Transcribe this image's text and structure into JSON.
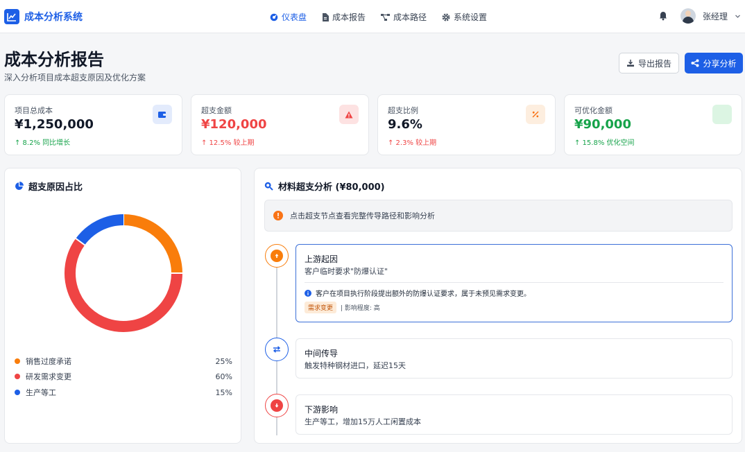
{
  "app": {
    "title": "成本分析系统"
  },
  "nav": [
    {
      "label": "仪表盘",
      "icon": "dashboard-icon",
      "active": true
    },
    {
      "label": "成本报告",
      "icon": "document-icon",
      "active": false
    },
    {
      "label": "成本路径",
      "icon": "network-icon",
      "active": false
    },
    {
      "label": "系统设置",
      "icon": "gear-icon",
      "active": false
    }
  ],
  "user": {
    "name": "张经理"
  },
  "page": {
    "title": "成本分析报告",
    "subtitle": "深入分析项目成本超支原因及优化方案"
  },
  "actions": {
    "export_label": "导出报告",
    "share_label": "分享分析"
  },
  "kpis": [
    {
      "label": "项目总成本",
      "value": "¥1,250,000",
      "delta": "↑ 8.2% 同比增长",
      "value_color": "#111827",
      "delta_color": "#16a34a",
      "icon": "wallet-icon",
      "icon_bg": "#e3ebfc",
      "icon_color": "#1d5fe6"
    },
    {
      "label": "超支金额",
      "value": "¥120,000",
      "delta": "↑ 12.5% 较上期",
      "value_color": "#ef4444",
      "delta_color": "#ef4444",
      "icon": "warning-icon",
      "icon_bg": "#fde2e2",
      "icon_color": "#ef4444"
    },
    {
      "label": "超支比例",
      "value": "9.6%",
      "delta": "↑ 2.3% 较上期",
      "value_color": "#111827",
      "delta_color": "#ef4444",
      "icon": "percent-icon",
      "icon_bg": "#fdeedf",
      "icon_color": "#f97316"
    },
    {
      "label": "可优化金额",
      "value": "¥90,000",
      "delta": "↑ 15.8% 优化空间",
      "value_color": "#16a34a",
      "delta_color": "#16a34a",
      "icon": "",
      "icon_bg": "#dcf5e3",
      "icon_color": "#16a34a"
    }
  ],
  "donut": {
    "title": "超支原因占比",
    "items": [
      {
        "label": "销售过度承诺",
        "pct": "25%",
        "value": 25,
        "color": "#f97d0b"
      },
      {
        "label": "研发需求变更",
        "pct": "60%",
        "value": 60,
        "color": "#ef4444"
      },
      {
        "label": "生产等工",
        "pct": "15%",
        "value": 15,
        "color": "#1d5fe6"
      }
    ]
  },
  "analysis": {
    "title": "材料超支分析 (¥80,000)",
    "hint": "点击超支节点查看完整传导路径和影响分析",
    "steps": [
      {
        "title": "上游起因",
        "desc": "客户临时要求\"防爆认证\"",
        "detail": "客户在项目执行阶段提出额外的防爆认证要求，属于未预见需求变更。",
        "tag": "需求变更",
        "impact": "| 影响程度: 高",
        "color": "#f97d0b",
        "icon": "arrow-up-icon"
      },
      {
        "title": "中间传导",
        "desc": "触发特种钢材进口，延迟15天",
        "color": "#1d5fe6",
        "icon": "exchange-icon"
      },
      {
        "title": "下游影响",
        "desc": "生产等工，增加15万人工闲置成本",
        "color": "#ef4444",
        "icon": "arrow-down-icon"
      }
    ]
  }
}
